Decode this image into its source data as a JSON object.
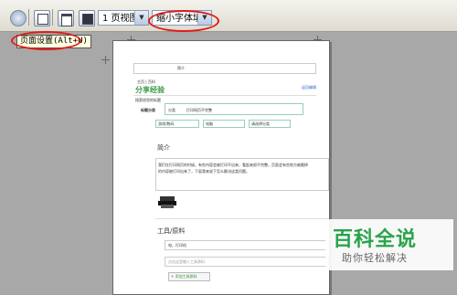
{
  "toolbar": {
    "view_select": "1 页视图",
    "zoom_select": "缩小字体填充",
    "tooltip": "页面设置(Alt+U)"
  },
  "document": {
    "top_link": "简介",
    "sub_label": "主页 | 百科",
    "logo_text": "分享经验",
    "right_link": "返回编辑",
    "search_label": "搜索经验的标题",
    "title_label": "标题分类",
    "category_label": "分类",
    "title_value": "打印网页不完整",
    "select1": "游戏/数码",
    "select2": "电脑",
    "select3": "请选择分类",
    "section_intro": "简介",
    "intro_text_1": "我们在打印网页的时候，有些内容会被打印不出来，看起来很不完整，页面会有些地方被截掉",
    "intro_text_2": "的内容被打印出来了，下面我来说下怎么解决这类问题。",
    "section_tools": "工具/原料",
    "tool_item_1": "电，打印机",
    "tool_item_2": "点击这里输入工具原料",
    "add_tool_button": "+ 添加工具原料"
  },
  "watermark": {
    "title": "百科全说",
    "subtitle": "助你轻松解决"
  }
}
